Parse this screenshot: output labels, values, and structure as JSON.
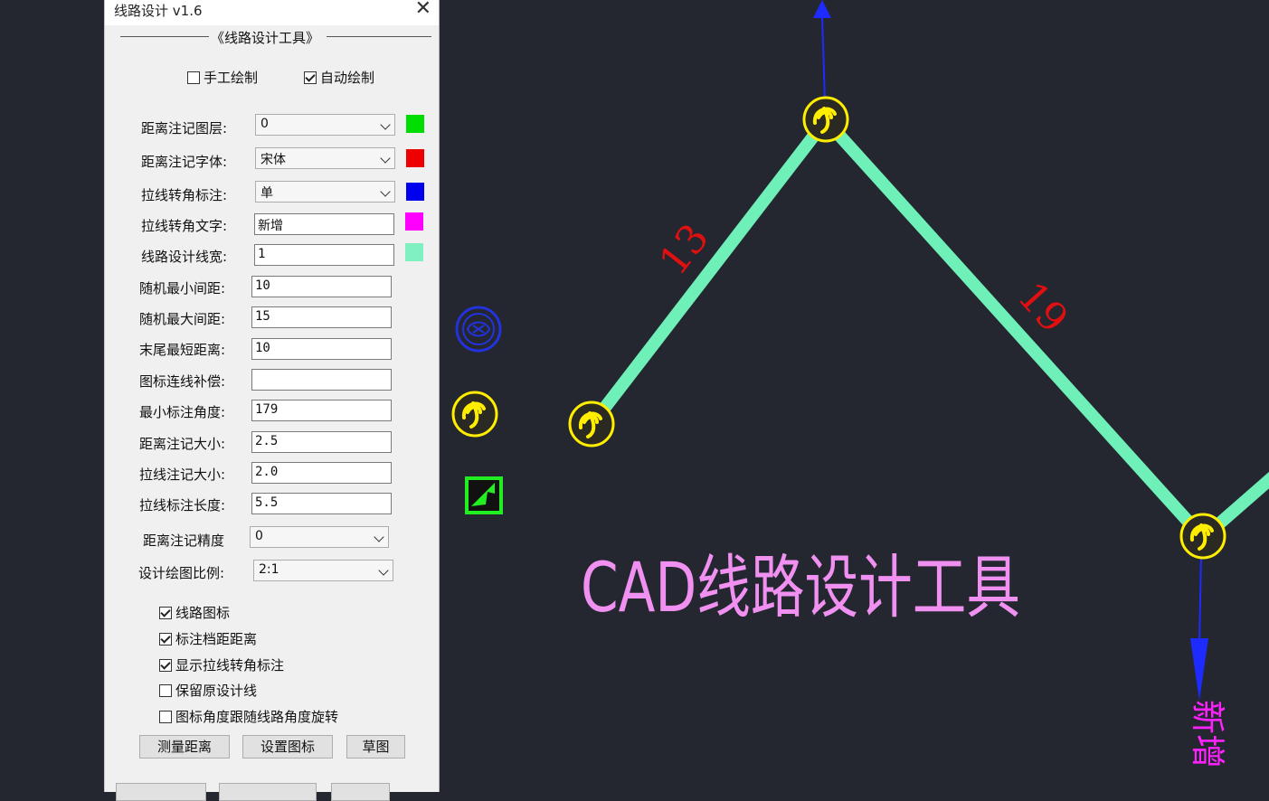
{
  "dialog": {
    "title": "线路设计 v1.6",
    "group_title": "《线路设计工具》",
    "mode_manual": {
      "label": "手工绘制",
      "checked": false
    },
    "mode_auto": {
      "label": "自动绘制",
      "checked": true
    },
    "fields": {
      "dist_layer": {
        "label": "距离注记图层:",
        "value": "0",
        "color": "#00dd00"
      },
      "dist_font": {
        "label": "距离注记字体:",
        "value": "宋体",
        "color": "#ee0000"
      },
      "guy_angle_mark": {
        "label": "拉线转角标注:",
        "value": "单",
        "color": "#0000ee"
      },
      "guy_angle_text": {
        "label": "拉线转角文字:",
        "value": "新增",
        "color": "#ff00ff"
      },
      "line_width": {
        "label": "线路设计线宽:",
        "value": "1",
        "color": "#80f0c0"
      },
      "rand_min": {
        "label": "随机最小间距:",
        "value": "10"
      },
      "rand_max": {
        "label": "随机最大间距:",
        "value": "15"
      },
      "tail_min": {
        "label": "末尾最短距离:",
        "value": "10"
      },
      "icon_comp": {
        "label": "图标连线补偿:",
        "value": ""
      },
      "min_angle": {
        "label": "最小标注角度:",
        "value": "179"
      },
      "dist_size": {
        "label": "距离注记大小:",
        "value": "2.5"
      },
      "guy_size": {
        "label": "拉线注记大小:",
        "value": "2.0"
      },
      "guy_len": {
        "label": "拉线标注长度:",
        "value": "5.5"
      },
      "dist_precision": {
        "label": "距离注记精度",
        "value": "0"
      },
      "scale": {
        "label": "设计绘图比例:",
        "value": "2:1"
      }
    },
    "options": [
      {
        "label": "线路图标",
        "checked": true
      },
      {
        "label": "标注档距距离",
        "checked": true
      },
      {
        "label": "显示拉线转角标注",
        "checked": true
      },
      {
        "label": "保留原设计线",
        "checked": false
      },
      {
        "label": "图标角度跟随线路角度旋转",
        "checked": false
      }
    ],
    "buttons": {
      "measure": "测量距离",
      "set_icon": "设置图标",
      "sketch": "草图"
    }
  },
  "canvas": {
    "banner": "CAD线路设计工具",
    "dim_left": "13",
    "dim_right": "19",
    "guy_text": "新增",
    "line_color": "#6ff0b8",
    "icon_color": "#ffee00"
  }
}
